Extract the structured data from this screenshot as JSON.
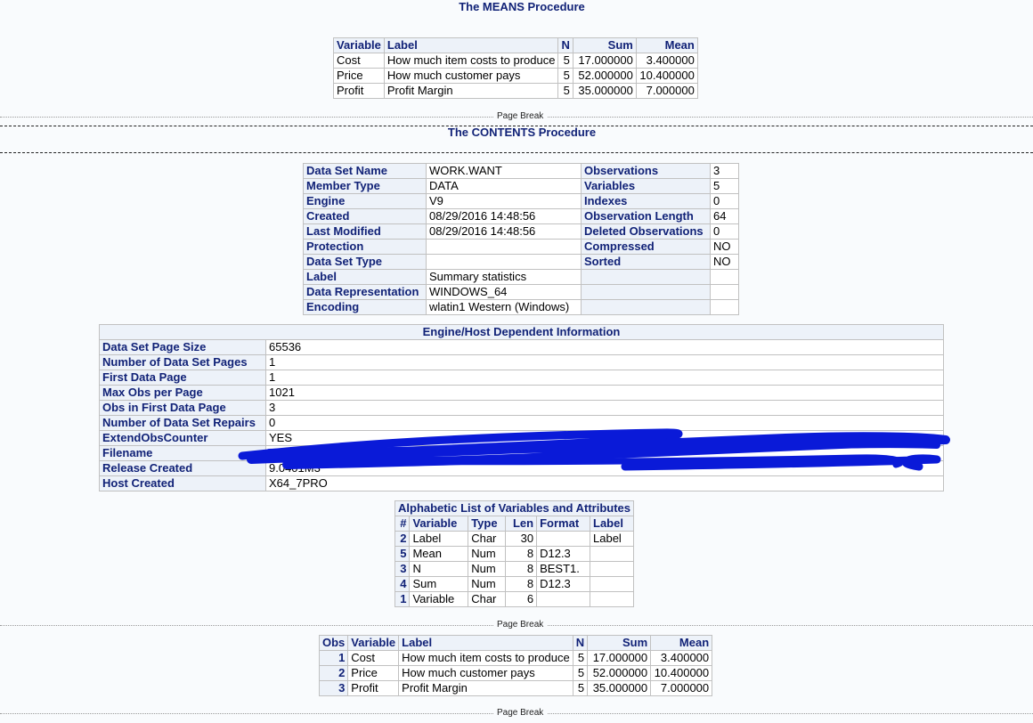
{
  "means": {
    "title": "The MEANS Procedure",
    "headers": [
      "Variable",
      "Label",
      "N",
      "Sum",
      "Mean"
    ],
    "rows": [
      [
        "Cost",
        "How much item costs to produce",
        "5",
        "17.000000",
        "3.400000"
      ],
      [
        "Price",
        "How much customer pays",
        "5",
        "52.000000",
        "10.400000"
      ],
      [
        "Profit",
        "Profit Margin",
        "5",
        "35.000000",
        "7.000000"
      ]
    ]
  },
  "page_break_label": "Page Break",
  "contents": {
    "title": "The CONTENTS Procedure",
    "attributes": [
      [
        "Data Set Name",
        "WORK.WANT",
        "Observations",
        "3"
      ],
      [
        "Member Type",
        "DATA",
        "Variables",
        "5"
      ],
      [
        "Engine",
        "V9",
        "Indexes",
        "0"
      ],
      [
        "Created",
        "08/29/2016 14:48:56",
        "Observation Length",
        "64"
      ],
      [
        "Last Modified",
        "08/29/2016 14:48:56",
        "Deleted Observations",
        "0"
      ],
      [
        "Protection",
        "",
        "Compressed",
        "NO"
      ],
      [
        "Data Set Type",
        "",
        "Sorted",
        "NO"
      ],
      [
        "Label",
        "Summary statistics",
        "",
        ""
      ],
      [
        "Data Representation",
        "WINDOWS_64",
        "",
        ""
      ],
      [
        "Encoding",
        "wlatin1  Western (Windows)",
        "",
        ""
      ]
    ]
  },
  "engine_host": {
    "title": "Engine/Host Dependent Information",
    "rows": [
      [
        "Data Set Page Size",
        "65536"
      ],
      [
        "Number of Data Set Pages",
        "1"
      ],
      [
        "First Data Page",
        "1"
      ],
      [
        "Max Obs per Page",
        "1021"
      ],
      [
        "Obs in First Data Page",
        "3"
      ],
      [
        "Number of Data Set Repairs",
        "0"
      ],
      [
        "ExtendObsCounter",
        "YES"
      ],
      [
        "Filename",
        ""
      ],
      [
        "Release Created",
        "9.0401M3"
      ],
      [
        "Host Created",
        "X64_7PRO"
      ]
    ],
    "redaction_color": "#0a1ad8"
  },
  "variables": {
    "title": "Alphabetic List of Variables and Attributes",
    "headers": [
      "#",
      "Variable",
      "Type",
      "Len",
      "Format",
      "Label"
    ],
    "rows": [
      [
        "2",
        "Label",
        "Char",
        "30",
        "",
        "Label"
      ],
      [
        "5",
        "Mean",
        "Num",
        "8",
        "D12.3",
        ""
      ],
      [
        "3",
        "N",
        "Num",
        "8",
        "BEST1.",
        ""
      ],
      [
        "4",
        "Sum",
        "Num",
        "8",
        "D12.3",
        ""
      ],
      [
        "1",
        "Variable",
        "Char",
        "6",
        "",
        ""
      ]
    ]
  },
  "print": {
    "headers": [
      "Obs",
      "Variable",
      "Label",
      "N",
      "Sum",
      "Mean"
    ],
    "rows": [
      [
        "1",
        "Cost",
        "How much item costs to produce",
        "5",
        "17.000000",
        "3.400000"
      ],
      [
        "2",
        "Price",
        "How much customer pays",
        "5",
        "52.000000",
        "10.400000"
      ],
      [
        "3",
        "Profit",
        "Profit Margin",
        "5",
        "35.000000",
        "7.000000"
      ]
    ]
  },
  "colors": {
    "header_text": "#112277",
    "header_bg": "#edf2f9",
    "page_bg": "#f9fbfd"
  }
}
